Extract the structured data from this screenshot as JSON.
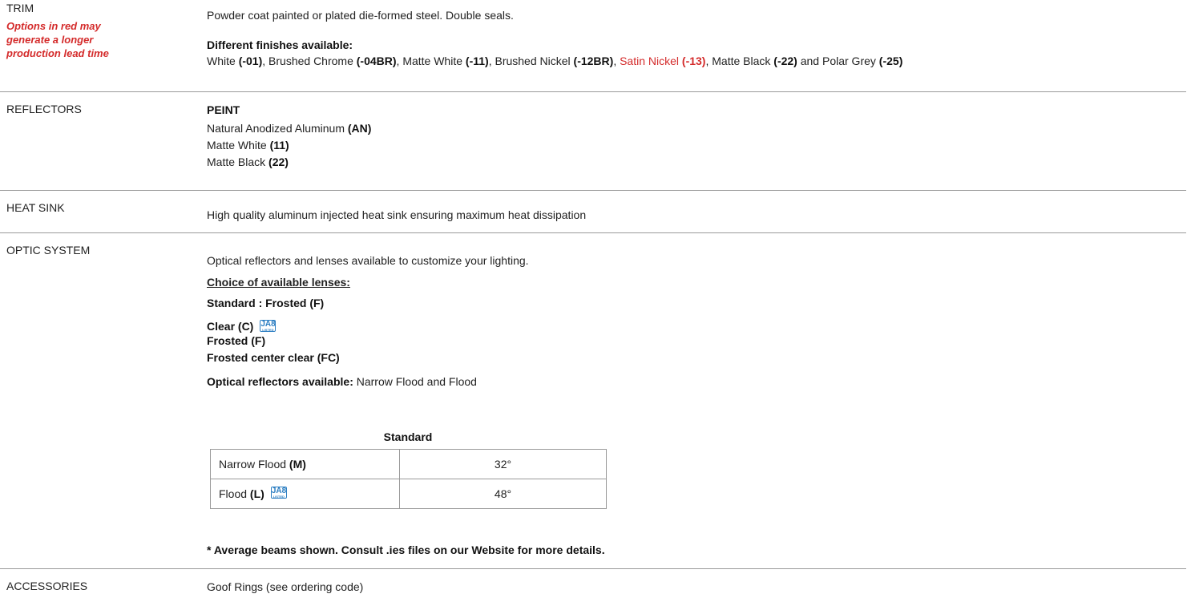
{
  "trim": {
    "label": "TRIM",
    "note": "Options in red may generate a longer production lead time",
    "description": "Powder coat painted or plated die-formed steel.  Double seals.",
    "finishes_title": "Different finishes available:",
    "finishes": [
      {
        "name": "White",
        "code": "(-01)",
        "sep": ", ",
        "red": false
      },
      {
        "name": "Brushed Chrome",
        "code": "(-04BR)",
        "sep": ", ",
        "red": false
      },
      {
        "name": "Matte White",
        "code": "(-11)",
        "sep": ", ",
        "red": false
      },
      {
        "name": "Brushed Nickel",
        "code": "(-12BR)",
        "sep": ", ",
        "red": false
      },
      {
        "name": "Satin Nickel",
        "code": "(-13)",
        "sep": ", ",
        "red": true
      },
      {
        "name": "Matte Black",
        "code": "(-22)",
        "sep": " and ",
        "red": false
      },
      {
        "name": "Polar Grey",
        "code": "(-25)",
        "sep": "",
        "red": false
      }
    ]
  },
  "reflectors": {
    "label": "REFLECTORS",
    "title": "PEINT",
    "items": [
      {
        "name": "Natural Anodized Aluminum",
        "code": "(AN)"
      },
      {
        "name": "Matte White",
        "code": "(11)"
      },
      {
        "name": "Matte Black",
        "code": "(22)"
      }
    ]
  },
  "heat_sink": {
    "label": "HEAT SINK",
    "description": "High quality aluminum injected heat sink ensuring maximum heat dissipation"
  },
  "optic": {
    "label": "OPTIC SYSTEM",
    "description": "Optical reflectors and lenses available to customize your lighting.",
    "lenses_title": "Choice of available lenses:",
    "standard_lens": "Standard : Frosted (F)",
    "lenses": [
      "Clear (C)",
      "Frosted (F)",
      "Frosted center clear (FC)"
    ],
    "reflectors_label": "Optical reflectors available:",
    "reflectors_value": "Narrow Flood and Flood",
    "table_header": "Standard",
    "beams": [
      {
        "name": "Narrow Flood",
        "code": "(M)",
        "value": "32°",
        "ja8": false
      },
      {
        "name": "Flood",
        "code": "(L)",
        "value": "48°",
        "ja8": true
      }
    ],
    "footnote": "* Average beams shown. Consult .ies files on our Website for more details.",
    "ja8_badge": {
      "text": "JA8",
      "sub": "LISTED"
    }
  },
  "accessories": {
    "label": "ACCESSORIES",
    "description": "Goof Rings (see ordering code)"
  },
  "colors": {
    "accent_red": "#d42b2b",
    "ja8_blue": "#2c7ec2",
    "divider": "#9a9a9a"
  }
}
